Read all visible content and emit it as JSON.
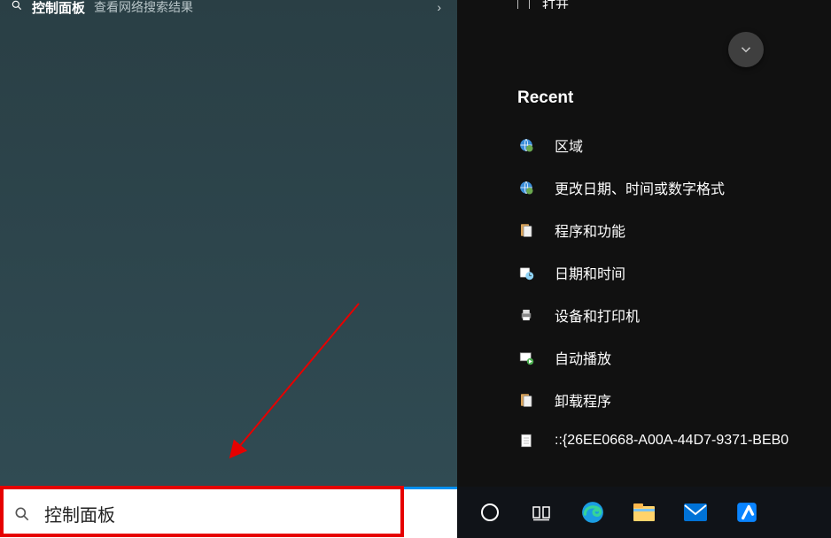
{
  "top_result": {
    "title": "控制面板",
    "subtitle": "查看网络搜索结果"
  },
  "detail": {
    "open_label": "打开",
    "recent_header": "Recent",
    "recent_items": [
      {
        "label": "区域",
        "icon": "globe-settings-icon"
      },
      {
        "label": "更改日期、时间或数字格式",
        "icon": "globe-settings-icon"
      },
      {
        "label": "程序和功能",
        "icon": "programs-icon"
      },
      {
        "label": "日期和时间",
        "icon": "datetime-icon"
      },
      {
        "label": "设备和打印机",
        "icon": "printer-icon"
      },
      {
        "label": "自动播放",
        "icon": "autoplay-icon"
      },
      {
        "label": "卸载程序",
        "icon": "programs-icon"
      },
      {
        "label": "::{26EE0668-A00A-44D7-9371-BEB0",
        "icon": "file-icon"
      }
    ]
  },
  "search": {
    "value": "控制面板"
  },
  "taskbar": {
    "items": [
      {
        "name": "cortana-icon"
      },
      {
        "name": "taskview-icon"
      },
      {
        "name": "edge-icon"
      },
      {
        "name": "explorer-icon"
      },
      {
        "name": "mail-icon"
      },
      {
        "name": "app-icon"
      }
    ]
  }
}
